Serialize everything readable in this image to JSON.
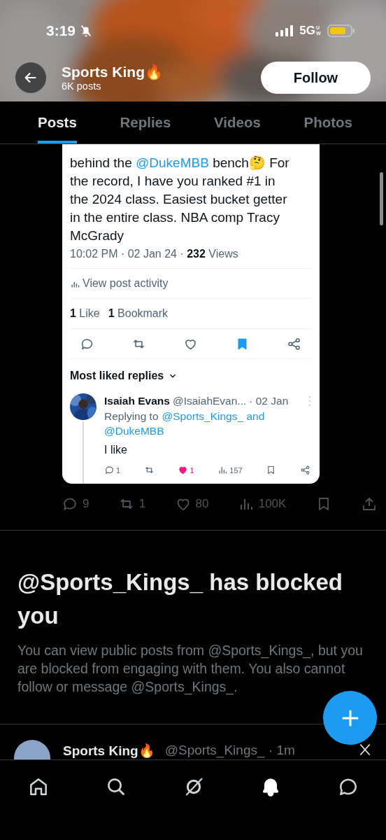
{
  "status_bar": {
    "time": "3:19",
    "network": "5G",
    "network_suffix": "UW"
  },
  "profile": {
    "name": "Sports King🔥",
    "posts": "6K posts",
    "follow": "Follow"
  },
  "tabs": [
    {
      "label": "Posts",
      "selected": true
    },
    {
      "label": "Replies",
      "selected": false
    },
    {
      "label": "Videos",
      "selected": false
    },
    {
      "label": "Photos",
      "selected": false
    }
  ],
  "embedded_post": {
    "text": [
      {
        "kind": "plain",
        "text": "behind the "
      },
      {
        "kind": "mention",
        "text": "@DukeMBB"
      },
      {
        "kind": "plain",
        "text": " bench🤔 For\nthe record, I have you ranked #1 in\nthe 2024 class. Easiest bucket getter\nin the entire class. NBA comp Tracy\nMcGrady"
      }
    ],
    "timestamp": "10:02 PM · 02 Jan 24 · **232** Views",
    "activity": "View post activity",
    "stats": [
      "**1** Like",
      "**1** Bookmark"
    ],
    "actions": [
      {
        "kind": "reply",
        "on": false
      },
      {
        "kind": "repost",
        "on": false
      },
      {
        "kind": "like",
        "on": false
      },
      {
        "kind": "bookmark",
        "on": true
      },
      {
        "kind": "share"
      }
    ],
    "sort": "Most liked replies",
    "reply": {
      "name": "Isaiah Evans",
      "handle": "@IsaiahEvan...",
      "date": "· 02 Jan",
      "replying": [
        {
          "kind": "plain",
          "text": "Replying to"
        },
        {
          "kind": "mention",
          "text": "@Sports_Kings_ and"
        },
        {
          "kind": "mention",
          "text": "@DukeMBB"
        }
      ],
      "text": "I like",
      "actions": [
        {
          "kind": "reply",
          "count": "1",
          "on": false
        },
        {
          "kind": "repost",
          "on": false
        },
        {
          "kind": "like",
          "count": "1",
          "on": true
        },
        {
          "kind": "views",
          "count": "157"
        },
        {
          "kind": "bookmark",
          "on": false
        },
        {
          "kind": "share"
        }
      ]
    }
  },
  "post_actions": [
    {
      "kind": "reply",
      "count": "9"
    },
    {
      "kind": "repost",
      "count": "1"
    },
    {
      "kind": "like",
      "count": "80"
    },
    {
      "kind": "views",
      "count": "100K"
    },
    {
      "kind": "bookmark"
    },
    {
      "kind": "export"
    }
  ],
  "blocked": {
    "title": "@Sports_Kings_ has blocked you",
    "body": "You can view public posts from @Sports_Kings_, but you are blocked from engaging with them. You also cannot follow or message @Sports_Kings_."
  },
  "next_post": {
    "name": "Sports King🔥",
    "handle": "@Sports_Kings_ · 1m"
  },
  "nav": [
    {
      "kind": "home",
      "selected": false
    },
    {
      "kind": "search",
      "selected": false
    },
    {
      "kind": "grok",
      "selected": false
    },
    {
      "kind": "notifications",
      "selected": true
    },
    {
      "kind": "messages",
      "selected": false
    }
  ]
}
